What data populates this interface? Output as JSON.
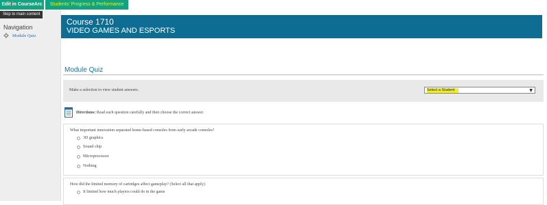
{
  "toolbar": {
    "edit_label": "Edit in CourseArc",
    "progress_label": "Students' Progress & Performance",
    "skip_label": "Skip to main content"
  },
  "sidebar": {
    "title": "Navigation",
    "items": [
      {
        "label": "Module Quiz",
        "icon": "gear-icon"
      }
    ]
  },
  "course": {
    "number": "Course 1710",
    "name": "VIDEO GAMES AND ESPORTS"
  },
  "quiz": {
    "title": "Module Quiz",
    "selection_prompt": "Make a selection to view student answers.",
    "student_select": {
      "value": "Select a Student",
      "highlight_color": "#f4f400"
    },
    "directions_label": "Directions:",
    "directions_text": "Read each question carefully and then choose the correct answer.",
    "questions": [
      {
        "text": "What important innovation separated home-based consoles from early arcade consoles?",
        "options": [
          "3D graphics",
          "Sound chip",
          "Microprocessor",
          "Nothing"
        ]
      },
      {
        "text": "How did the limited memory of cartridges affect gameplay? (Select all that apply)",
        "options": [
          "It limited how much players could do in the game"
        ]
      }
    ]
  },
  "colors": {
    "accent_green": "#14a37f",
    "banner_blue": "#0d6d92",
    "link_blue": "#1d6fa5",
    "highlight_yellow": "#f4f400"
  }
}
